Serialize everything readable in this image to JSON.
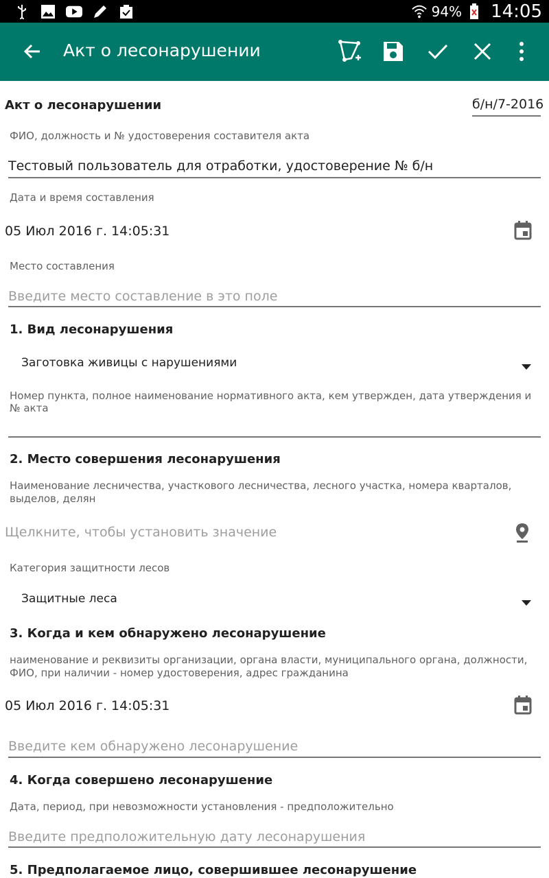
{
  "status_bar": {
    "icons": [
      "usb-icon",
      "gallery-icon",
      "youtube-icon",
      "pen-icon",
      "clipboard-check-icon"
    ],
    "battery": "94%",
    "time": "14:05"
  },
  "app_bar": {
    "title": "Акт о лесонарушении",
    "actions": [
      "polygon-add-icon",
      "save-icon",
      "check-icon",
      "close-icon",
      "more-vert-icon"
    ]
  },
  "form": {
    "header_title": "Акт о лесонарушении",
    "act_number": "б/н/7-2016",
    "author_label": "ФИО, должность и № удостоверения составителя акта",
    "author_value": "Тестовый пользователь для отработки, удостоверение № б/н",
    "datetime_label": "Дата и время составления",
    "datetime_value": "05 Июл 2016 г. 14:05:31",
    "place_label": "Место составления",
    "place_placeholder": "Введите место составление в это поле",
    "section1_title": "1. Вид лесонарушения",
    "violation_type": "Заготовка живицы с нарушениями",
    "normative_label": "Номер пункта, полное наименование нормативного акта, кем утвержден, дата утверждения и № акта",
    "section2_title": "2. Место совершения лесонарушения",
    "location_label": "Наименование лесничества, участкового лесничества, лесного участка, номера кварталов, выделов, делян",
    "location_placeholder": "Щелкните, чтобы установить значение",
    "category_label": "Категория защитности лесов",
    "category_value": "Защитные леса",
    "section3_title": "3. Когда и кем обнаружено лесонарушение",
    "detected_label": "наименование и реквизиты организации, органа власти, муниципального органа, должности, ФИО, при наличии - номер удостоверения, адрес гражданина",
    "detected_datetime": "05 Июл 2016 г. 14:05:31",
    "detected_by_placeholder": "Введите кем обнаружено лесонарушение",
    "section4_title": "4. Когда совершено лесонарушение",
    "committed_label": "Дата, период, при невозможности установления - предположительно",
    "committed_placeholder": "Введите предположительную дату лесонарушения",
    "section5_title": "5. Предполагаемое лицо, совершившее лесонарушение"
  },
  "colors": {
    "app_bar": "#00796b",
    "status_bar": "#000000"
  }
}
